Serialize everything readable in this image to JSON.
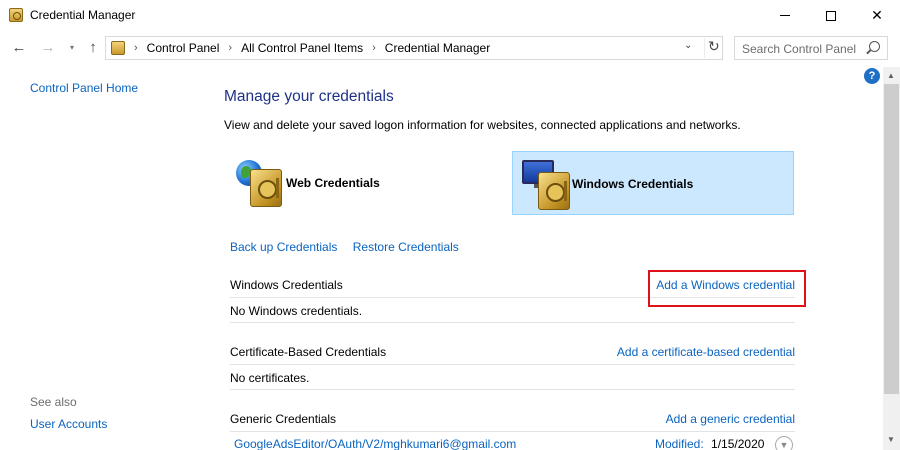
{
  "window": {
    "title": "Credential Manager",
    "controls": {
      "minimize": "",
      "maximize": "",
      "close": "✕"
    }
  },
  "nav": {
    "back": "←",
    "forward": "→",
    "recent": "▾",
    "up": "↑",
    "breadcrumb": [
      "Control Panel",
      "All Control Panel Items",
      "Credential Manager"
    ],
    "breadcrumb_separator": "›",
    "dropdown": "⌄",
    "refresh": "↻",
    "search_placeholder": "Search Control Panel"
  },
  "help": {
    "label": "?"
  },
  "sidebar": {
    "home": "Control Panel Home",
    "see_also": "See also",
    "links": [
      "User Accounts"
    ]
  },
  "main": {
    "title": "Manage your credentials",
    "description": "View and delete your saved logon information for websites, connected applications and networks.",
    "tiles": [
      {
        "label": "Web Credentials",
        "icon": "globe-vault-icon",
        "selected": false
      },
      {
        "label": "Windows Credentials",
        "icon": "computer-vault-icon",
        "selected": true
      }
    ],
    "actions": [
      "Back up Credentials",
      "Restore Credentials"
    ],
    "sections": [
      {
        "title": "Windows Credentials",
        "add_label": "Add a Windows credential",
        "empty_text": "No Windows credentials."
      },
      {
        "title": "Certificate-Based Credentials",
        "add_label": "Add a certificate-based credential",
        "empty_text": "No certificates."
      },
      {
        "title": "Generic Credentials",
        "add_label": "Add a generic credential"
      }
    ],
    "generic_items": [
      {
        "name": "GoogleAdsEditor/OAuth/V2/mghkumari6@gmail.com",
        "modified_label": "Modified:",
        "modified_date": "1/15/2020"
      }
    ]
  },
  "scrollbar": {
    "up": "▲",
    "down": "▼"
  },
  "colors": {
    "link": "#0b64c0",
    "title": "#1e3287",
    "selected_tile": "#cce8ff",
    "highlight": "#e0101a"
  }
}
